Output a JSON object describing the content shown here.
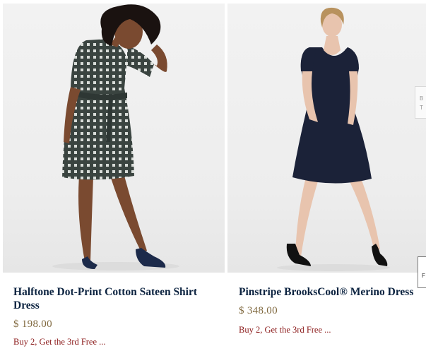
{
  "products": [
    {
      "name": "Halftone Dot-Print Cotton Sateen Shirt Dress",
      "price": "$ 198.00",
      "promo": "Buy 2, Get the 3rd Free ...",
      "dress_color": "#3a4440",
      "shoe_color": "#1c2a4a"
    },
    {
      "name": "Pinstripe BrooksCool® Merino Dress",
      "price": "$ 348.00",
      "promo": "Buy 2, Get the 3rd Free ...",
      "dress_color": "#1b2238",
      "shoe_color": "#111111"
    }
  ],
  "side_tab": {
    "line1": "B",
    "line2": "T"
  },
  "side_box": {
    "text": "F"
  },
  "colors": {
    "name": "#0c2340",
    "price": "#80693f",
    "promo": "#8b1a1a"
  }
}
